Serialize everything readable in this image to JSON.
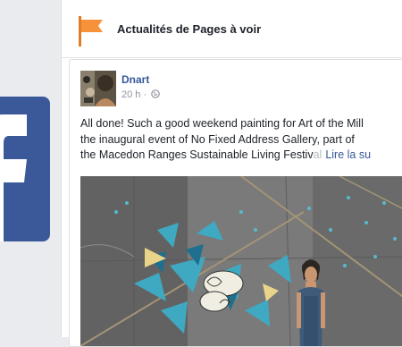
{
  "panel": {
    "title": "Actualités de Pages à voir"
  },
  "post": {
    "author": "Dnart",
    "time": "20 h",
    "separator": "·",
    "text_lines": [
      "All done! Such a good weekend painting for Art of the Mill",
      "the inaugural event of No Fixed Address Gallery, part of",
      "the Macedon Ranges Sustainable Living Festiv"
    ],
    "text_fade": "al",
    "see_more": "Lire la su"
  },
  "icons": {
    "logo": "facebook-logo",
    "header": "flag-icon",
    "privacy": "globe-icon"
  },
  "colors": {
    "brand_blue": "#3b5998",
    "link_blue": "#365899",
    "flag_orange": "#f7923a",
    "background": "#e9ebee"
  }
}
